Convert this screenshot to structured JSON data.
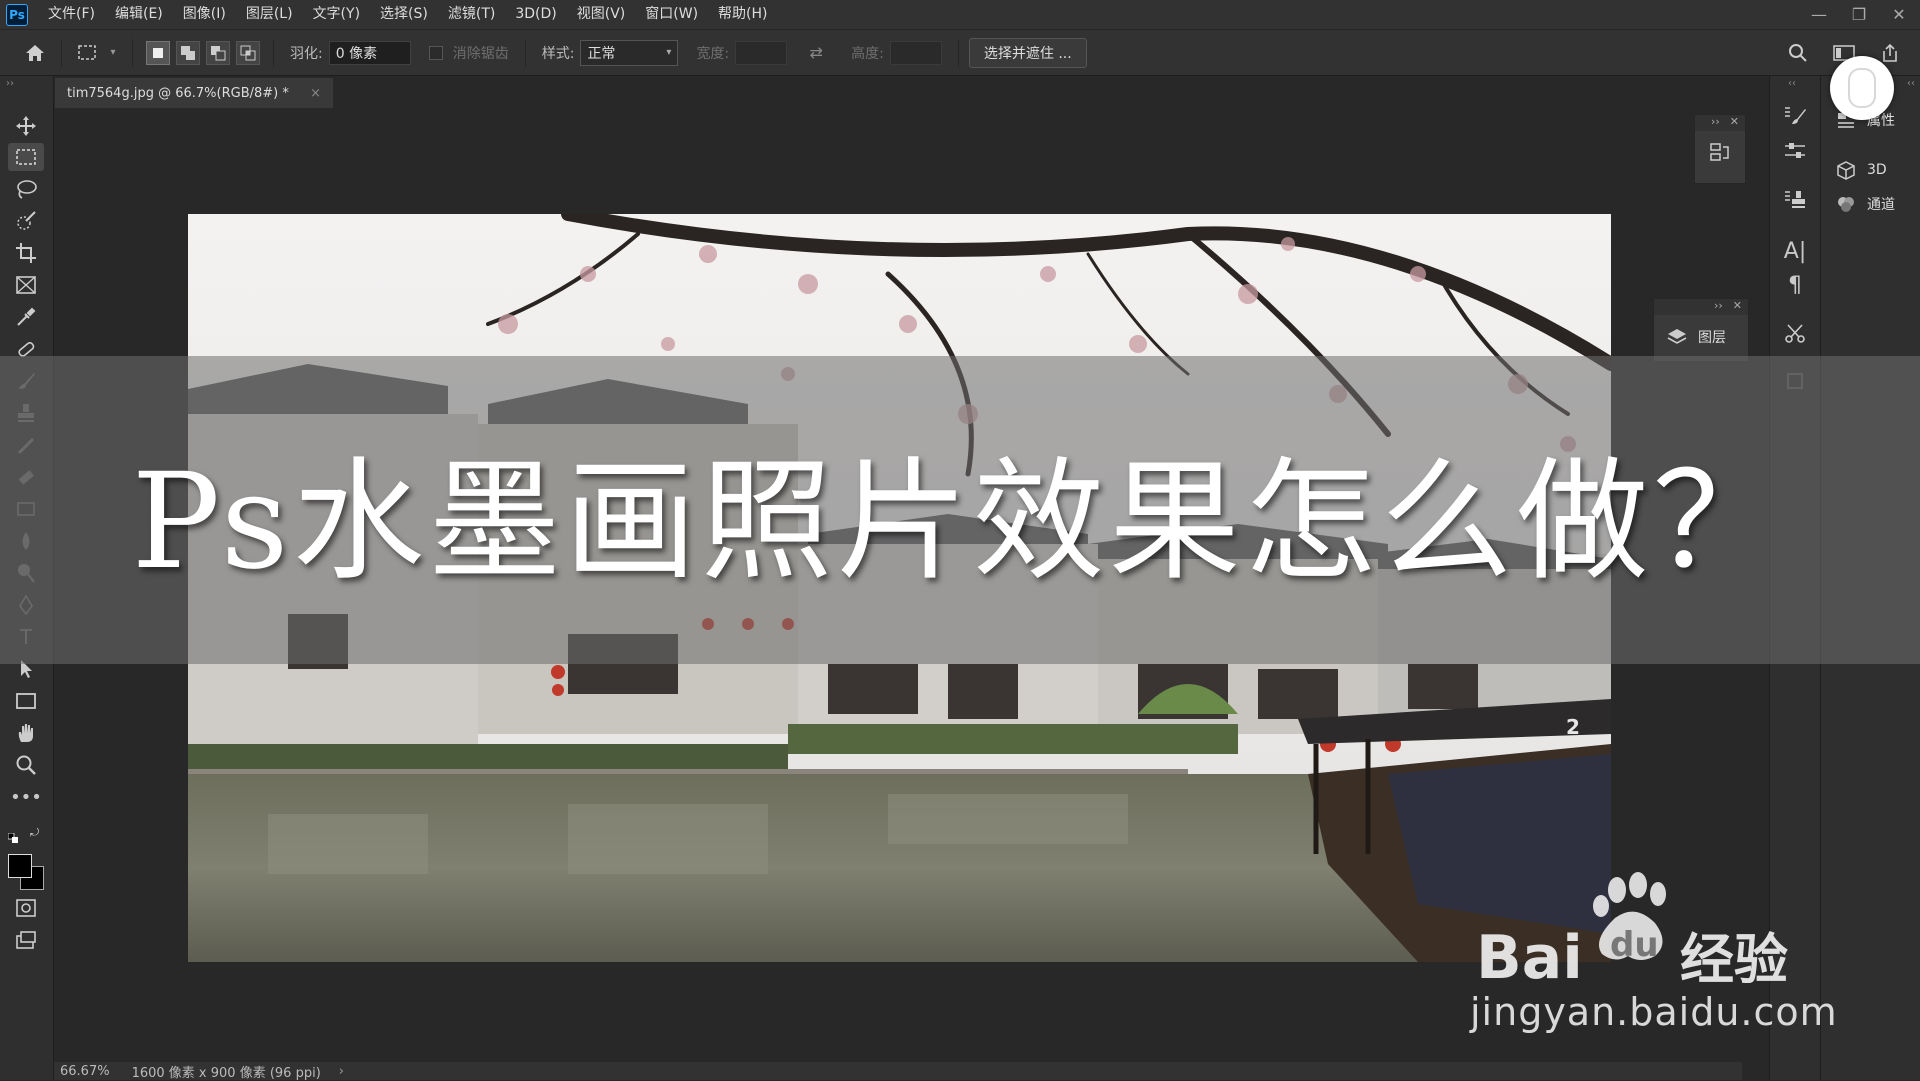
{
  "app": {
    "logo": "Ps"
  },
  "menu": [
    "文件(F)",
    "编辑(E)",
    "图像(I)",
    "图层(L)",
    "文字(Y)",
    "选择(S)",
    "滤镜(T)",
    "3D(D)",
    "视图(V)",
    "窗口(W)",
    "帮助(H)"
  ],
  "window_controls": {
    "minimize": "—",
    "restore": "❐",
    "close": "✕"
  },
  "options": {
    "feather_label": "羽化:",
    "feather_value": "0 像素",
    "antialias_label": "消除锯齿",
    "style_label": "样式:",
    "style_value": "正常",
    "width_label": "宽度:",
    "height_label": "高度:",
    "select_mask_button": "选择并遮住 ..."
  },
  "document": {
    "tab_title": "tim7564g.jpg @ 66.7%(RGB/8#) *",
    "tab_close": "×"
  },
  "status": {
    "zoom": "66.67%",
    "info": "1600 像素 x 900 像素 (96 ppi)",
    "arrow": "›"
  },
  "right_panel": {
    "properties": "属性",
    "3d": "3D",
    "channels": "通道",
    "layers": "图层"
  },
  "overlay": {
    "title": "Ps水墨画照片效果怎么做？"
  },
  "watermark": {
    "brand": "Bai",
    "brand2": "du",
    "exp": "经验",
    "url": "jingyan.baidu.com"
  },
  "photo": {
    "boat_number": "2"
  },
  "colors": {
    "accent": "#31a8ff",
    "banner": "#6e6e6e"
  }
}
